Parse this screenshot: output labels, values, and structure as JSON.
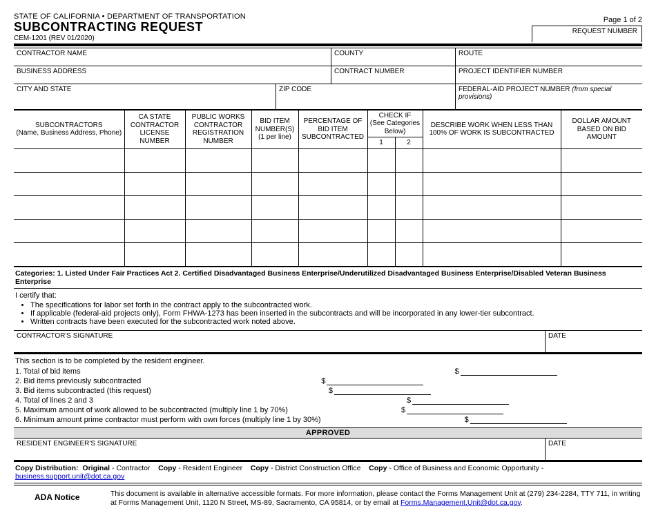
{
  "header": {
    "dept": "STATE OF CALIFORNIA • DEPARTMENT OF TRANSPORTATION",
    "title": "SUBCONTRACTING REQUEST",
    "form_no": "CEM-1201 (REV 01/2020)",
    "page": "Page 1 of 2",
    "request_number_label": "REQUEST NUMBER"
  },
  "fields": {
    "contractor_name": "CONTRACTOR NAME",
    "county": "COUNTY",
    "route": "ROUTE",
    "business_address": "BUSINESS ADDRESS",
    "contract_number": "CONTRACT NUMBER",
    "project_identifier": "PROJECT IDENTIFIER NUMBER",
    "city_state": "CITY AND STATE",
    "zip": "ZIP CODE",
    "fed_aid": "FEDERAL-AID PROJECT NUMBER",
    "fed_aid_note": "(from special provisions)"
  },
  "grid": {
    "col_subs": "SUBCONTRACTORS",
    "col_subs_sub": "(Name, Business Address, Phone)",
    "col_license": "CA STATE CONTRACTOR LICENSE NUMBER",
    "col_pwcr": "PUBLIC WORKS CONTRACTOR REGISTRATION NUMBER",
    "col_bid": "BID ITEM NUMBER(S)",
    "col_bid_sub": "(1 per line)",
    "col_pct": "PERCENTAGE OF BID ITEM SUBCONTRACTED",
    "col_check": "CHECK IF",
    "col_check_sub": "(See Categories Below)",
    "col_c1": "1",
    "col_c2": "2",
    "col_desc": "DESCRIBE WORK WHEN LESS THAN 100% OF WORK IS SUBCONTRACTED",
    "col_amount": "DOLLAR AMOUNT BASED ON BID AMOUNT"
  },
  "categories": "Categories:  1. Listed Under Fair Practices Act  2. Certified Disadvantaged Business Enterprise/Underutilized Disadvantaged Business Enterprise/Disabled Veteran Business Enterprise",
  "cert": {
    "intro": "I certify that:",
    "b1": "The specifications for labor set forth in the contract apply to the subcontracted work.",
    "b2": "If applicable (federal-aid projects only), Form FHWA-1273 has been inserted in the subcontracts and will be incorporated in any lower-tier subcontract.",
    "b3": "Written contracts have been executed for the subcontracted work noted above."
  },
  "sig": {
    "contractor": "CONTRACTOR'S SIGNATURE",
    "date": "DATE",
    "re_intro": "This section is to be completed by the resident engineer.",
    "l1": "1.  Total of bid items",
    "l2": "2.  Bid items previously subcontracted",
    "l3": "3.  Bid items subcontracted (this request)",
    "l4": "4.  Total of lines 2 and 3",
    "l5": "5.  Maximum amount of work allowed to be subcontracted (multiply line 1 by 70%)",
    "l6": "6.  Minimum amount prime contractor must perform with own forces (multiply line 1 by 30%)",
    "approved": "APPROVED",
    "resident": "RESIDENT ENGINEER'S SIGNATURE"
  },
  "copy": {
    "label": "Copy Distribution:",
    "c1a": "Original",
    "c1b": " - Contractor",
    "c2a": "Copy",
    "c2b": " - Resident Engineer",
    "c3a": "Copy",
    "c3b": " - District Construction Office",
    "c4a": "Copy",
    "c4b": " - Office of Business and Economic Opportunity - ",
    "email": "business.support.unit@dot.ca.gov"
  },
  "ada": {
    "title": "ADA Notice",
    "body1": "This document is available in alternative accessible formats. For more information, please contact the Forms Management Unit at (279) 234-2284, TTY 711, in writing at Forms Management Unit, 1120 N Street, MS-89, Sacramento, CA 95814, or by email at ",
    "email": "Forms.Management.Unit@dot.ca.gov",
    "body2": "."
  }
}
